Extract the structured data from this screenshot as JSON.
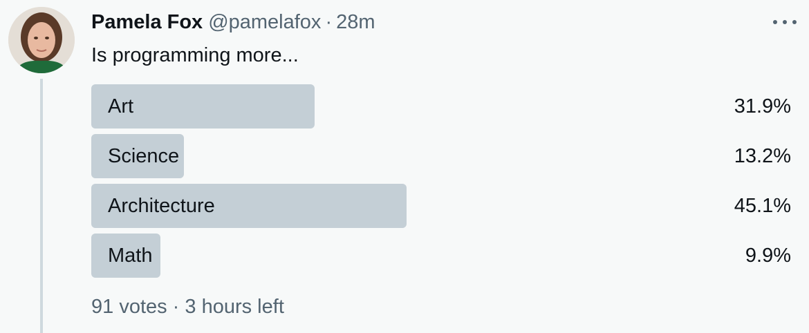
{
  "author": {
    "display_name": "Pamela Fox",
    "handle": "@pamelafox",
    "separator": "·",
    "time": "28m",
    "avatar_icon": "profile-photo"
  },
  "tweet": {
    "text": "Is programming more..."
  },
  "poll": {
    "options": [
      {
        "label": "Art",
        "percent_label": "31.9%",
        "percent": 31.9
      },
      {
        "label": "Science",
        "percent_label": "13.2%",
        "percent": 13.2
      },
      {
        "label": "Architecture",
        "percent_label": "45.1%",
        "percent": 45.1
      },
      {
        "label": "Math",
        "percent_label": "9.9%",
        "percent": 9.9
      }
    ],
    "meta": "91 votes · 3 hours left"
  },
  "colors": {
    "bar": "#c4cfd6",
    "secondary_text": "#536471",
    "primary_text": "#0f1419",
    "background": "#f7f9f9"
  }
}
